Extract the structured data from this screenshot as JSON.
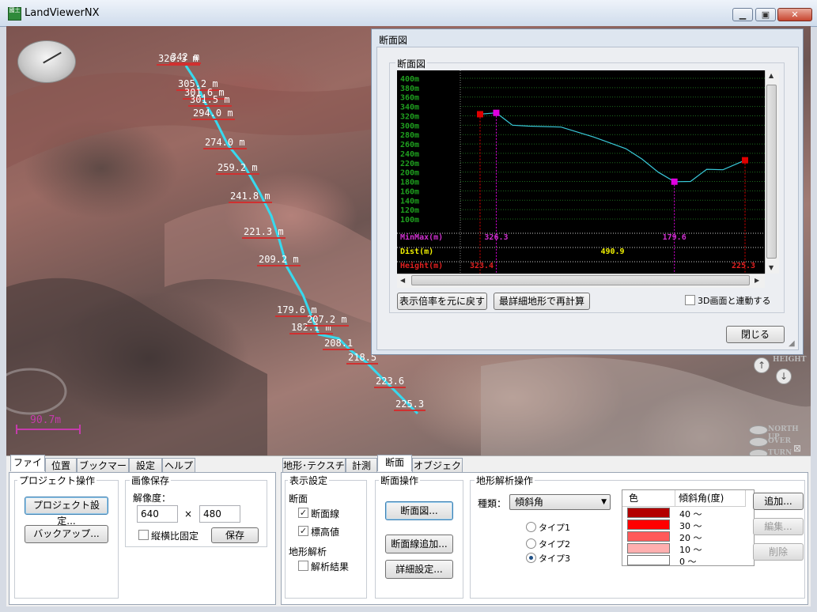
{
  "window": {
    "title": "LandViewerNX",
    "app_icon_text": "國土"
  },
  "viewport": {
    "scale_label": "90.7m",
    "elevation_labels": [
      "326.3 m",
      "342 m",
      "305.2 m",
      "301.6 m",
      "301.5 m",
      "294.0 m",
      "274.0 m",
      "259.2 m",
      "241.8 m",
      "221.3 m",
      "209.2 m",
      "179.6 m",
      "182.1 m",
      "207.2 m",
      "208.1",
      "218.5",
      "223.6",
      "225.3"
    ],
    "nav": {
      "height": "HEIGHT",
      "north_up": "NORTH UP",
      "over": "OVER",
      "turn": "TURN",
      "close_glyph": "⊠"
    }
  },
  "profile_dialog": {
    "title": "断面図",
    "group_title": "断面図",
    "reset_zoom_button": "表示倍率を元に戻す",
    "recalc_button": "最詳細地形で再計算",
    "sync_3d_label": "3D画面と連動する",
    "sync_3d_checked": false,
    "close_button": "閉じる"
  },
  "chart_data": {
    "type": "line",
    "y_ticks": [
      "400m",
      "380m",
      "360m",
      "340m",
      "320m",
      "300m",
      "280m",
      "260m",
      "240m",
      "220m",
      "200m",
      "180m",
      "160m",
      "140m",
      "120m",
      "100m"
    ],
    "ylim": [
      100,
      400
    ],
    "x_range": [
      0,
      490.9
    ],
    "series": [
      {
        "x": [
          0,
          30,
          60,
          90,
          150,
          210,
          270,
          300,
          330,
          360,
          390,
          420,
          450,
          490.9
        ],
        "y": [
          323.4,
          326.3,
          300,
          298,
          296,
          275,
          250,
          228,
          200,
          179.6,
          180,
          206,
          205,
          225.3
        ]
      }
    ],
    "markers": [
      {
        "x": 0,
        "y": 323.4,
        "color": "#e00000"
      },
      {
        "x": 30,
        "y": 326.3,
        "color": "#e000e0"
      },
      {
        "x": 360,
        "y": 179.6,
        "color": "#e000e0"
      },
      {
        "x": 490.9,
        "y": 225.3,
        "color": "#e00000"
      }
    ],
    "minmax_label": "MinMax(m)",
    "dist_label": "Dist(m)",
    "height_label": "Height(m)",
    "minmax_values": [
      "326.3",
      "179.6"
    ],
    "dist_value": "490.9",
    "height_values": [
      "323.4",
      "225.3"
    ],
    "colors": {
      "line": "#39c9d9",
      "tick_text": "#1fa01f",
      "minmax": "#d030d0",
      "dist": "#f0f000",
      "height": "#e02020",
      "grid": "#1d6b1d"
    }
  },
  "bottom_panel": {
    "left_tabs": [
      "ファイル",
      "位置",
      "ブックマーク",
      "設定",
      "ヘルプ"
    ],
    "left_active_tab": 0,
    "project_group": {
      "title": "プロジェクト操作",
      "settings_button": "プロジェクト設定...",
      "backup_button": "バックアップ..."
    },
    "image_save_group": {
      "title": "画像保存",
      "resolution_label": "解像度：",
      "width_value": "640",
      "times": "×",
      "height_value": "480",
      "keep_aspect_label": "縦横比固定",
      "keep_aspect_checked": false,
      "save_button": "保存"
    },
    "right_tabs": [
      "地形･テクスチャ",
      "計測",
      "断面",
      "オブジェクト"
    ],
    "right_active_tab": 2,
    "display_group": {
      "title": "表示設定",
      "section_label": "断面",
      "profile_line_label": "断面線",
      "profile_line_checked": true,
      "elevation_label": "標高値",
      "elevation_checked": true,
      "analysis_label": "地形解析",
      "analysis_result_label": "解析結果",
      "analysis_result_checked": false
    },
    "profile_ops_group": {
      "title": "断面操作",
      "profile_button": "断面図...",
      "add_line_button": "断面線追加...",
      "detail_settings_button": "詳細設定..."
    },
    "terrain_analysis_group": {
      "title": "地形解析操作",
      "type_label": "種類：",
      "type_value": "傾斜角",
      "radios": [
        "タイプ1",
        "タイプ2",
        "タイプ3"
      ],
      "radio_selected": 2,
      "table_headers": {
        "color": "色",
        "slope": "傾斜角(度)"
      },
      "table_rows": [
        {
          "color": "#b30000",
          "value": "40 〜"
        },
        {
          "color": "#ff0000",
          "value": "30 〜"
        },
        {
          "color": "#ff5a5a",
          "value": "20 〜"
        },
        {
          "color": "#ffafaf",
          "value": "10 〜"
        },
        {
          "color": "#ffffff",
          "value": "0 〜"
        }
      ],
      "add_button": "追加...",
      "edit_button": "編集...",
      "delete_button": "削除"
    }
  }
}
